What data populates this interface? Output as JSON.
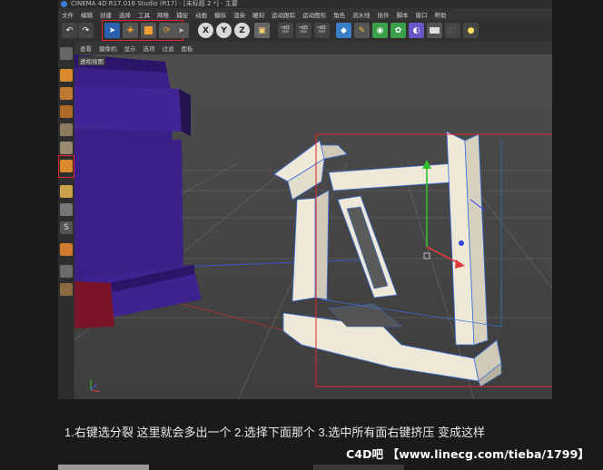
{
  "window": {
    "title": "CINEMA 4D R17.016 Studio (R17) - [未标题 2 *] - 主要"
  },
  "menubar": {
    "items": [
      "文件",
      "编辑",
      "创建",
      "选择",
      "工具",
      "网格",
      "捕捉",
      "动画",
      "模拟",
      "渲染",
      "雕刻",
      "运动跟踪",
      "运动图形",
      "角色",
      "流水线",
      "插件",
      "脚本",
      "窗口",
      "帮助"
    ]
  },
  "toolbar": {
    "axis_x": "X",
    "axis_y": "Y",
    "axis_z": "Z"
  },
  "viewport_menu": {
    "items": [
      "查看",
      "摄像机",
      "显示",
      "选项",
      "过滤",
      "面板"
    ]
  },
  "viewport": {
    "label": "透视视图"
  },
  "caption": {
    "text": "1.右键选分裂 这里就会多出一个 2.选择下面那个 3.选中所有面右键挤压 变成这样"
  },
  "watermark": {
    "text": "C4D吧 【www.linecg.com/tieba/1799】"
  },
  "colors": {
    "highlight_border": "#e0242c",
    "extrude_face": "#eee8d8",
    "purple_object": "#3a1f86",
    "viewport_bg": "#4a4a4a"
  }
}
